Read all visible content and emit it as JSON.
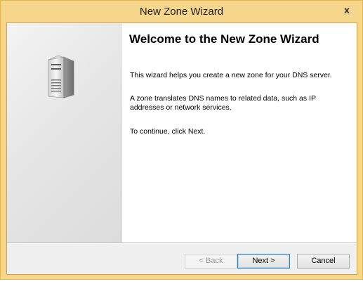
{
  "window": {
    "title": "New Zone Wizard",
    "close_glyph": "x",
    "accent_color": "#f6d68b"
  },
  "page": {
    "heading": "Welcome to the New Zone Wizard",
    "paragraphs": [
      "This wizard helps you create a new zone for your DNS server.",
      "A zone translates DNS names to related data, such as IP addresses or network services.",
      "To continue, click Next."
    ],
    "illustration_icon": "server-icon"
  },
  "buttons": {
    "back": "< Back",
    "next": "Next >",
    "cancel": "Cancel"
  }
}
